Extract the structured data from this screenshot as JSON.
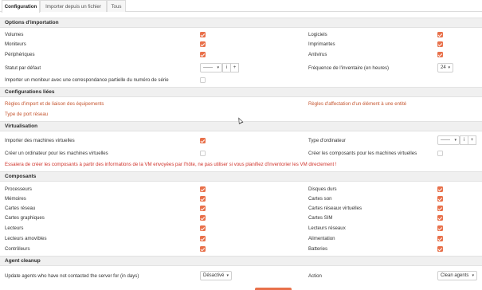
{
  "tabs": [
    "Configuration",
    "Importer depuis un fichier",
    "Tous"
  ],
  "sections": {
    "import_options": "Options d'importation",
    "linked_configs": "Configurations liées",
    "virtualization": "Virtualisation",
    "components": "Composants",
    "agent_cleanup": "Agent cleanup"
  },
  "import": {
    "volumes": "Volumes",
    "moniteurs": "Moniteurs",
    "peripheriques": "Périphériques",
    "statut_par_defaut": "Statut par défaut",
    "statut_value": "------",
    "import_moniteur_partiel": "Importer un moniteur avec une correspondance partielle du numéro de série",
    "logiciels": "Logiciels",
    "imprimantes": "Imprimantes",
    "antivirus": "Antivirus",
    "frequence": "Fréquence de l'inventaire (en heures)",
    "frequence_value": "24"
  },
  "linked": {
    "regles_import": "Règles d'import et de liaison des équipements",
    "type_port": "Type de port réseau",
    "regles_affectation": "Règles d'affectation d'un élément à une entité"
  },
  "virt": {
    "importer_vm": "Importer des machines virtuelles",
    "creer_ordinateur": "Créer un ordinateur pour les machines virtuelles",
    "type_ordinateur": "Type d'ordinateur",
    "type_value": "------",
    "creer_composants": "Créer les composants pour les machines virtuelles",
    "warning": "Essaiera de créer les composants à partir des informations de la VM envoyées par l'hôte, ne pas utiliser si vous planifiez d'inventorier les VM directement !"
  },
  "components": {
    "left": [
      "Processeurs",
      "Mémoires",
      "Cartes réseau",
      "Cartes graphiques",
      "Lecteurs",
      "Lecteurs amovibles",
      "Contrôleurs"
    ],
    "right": [
      "Disques durs",
      "Cartes son",
      "Cartes réseaux virtuelles",
      "Cartes SIM",
      "Lecteurs réseaux",
      "Alimentation",
      "Batteries"
    ]
  },
  "agent": {
    "update_label": "Update agents who have not contacted the server for (in days)",
    "update_value": "Désactivé",
    "action_label": "Action",
    "action_value": "Clean agents"
  },
  "icons": {
    "info": "i",
    "plus": "+",
    "caret": "▾"
  },
  "colors": {
    "accent": "#e8704a",
    "link": "#c5552f",
    "warning": "#d0342c"
  }
}
